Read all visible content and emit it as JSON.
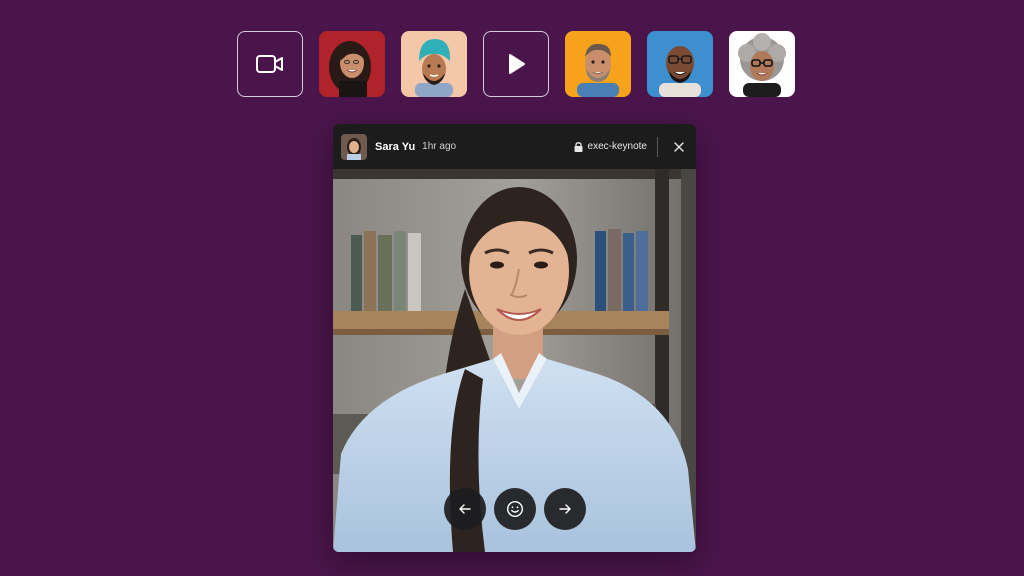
{
  "strip": {
    "items": [
      {
        "type": "action",
        "icon": "video-camera-icon"
      },
      {
        "type": "avatar",
        "person": "woman-dark-hair",
        "bg": "#b0232a"
      },
      {
        "type": "avatar",
        "person": "man-teal-turban",
        "bg": "#f3c7a8"
      },
      {
        "type": "action",
        "icon": "play-icon"
      },
      {
        "type": "avatar",
        "person": "man-grey-beard",
        "bg": "#f6a21a"
      },
      {
        "type": "avatar",
        "person": "man-glasses",
        "bg": "#3e8fd0"
      },
      {
        "type": "avatar",
        "person": "woman-grey-curly-hair",
        "bg": "#ffffff"
      }
    ]
  },
  "clip": {
    "author": "Sara Yu",
    "time": "1hr ago",
    "channel": "exec-keynote",
    "channel_icon": "lock-icon",
    "close_icon": "close-icon",
    "controls": [
      {
        "name": "previous-clip-button",
        "icon": "arrow-left-icon"
      },
      {
        "name": "react-emoji-button",
        "icon": "smiley-icon"
      },
      {
        "name": "next-clip-button",
        "icon": "arrow-right-icon"
      }
    ]
  },
  "colors": {
    "background": "#4a154b",
    "header": "#1d1c1d",
    "control": "#1c1c1e"
  }
}
